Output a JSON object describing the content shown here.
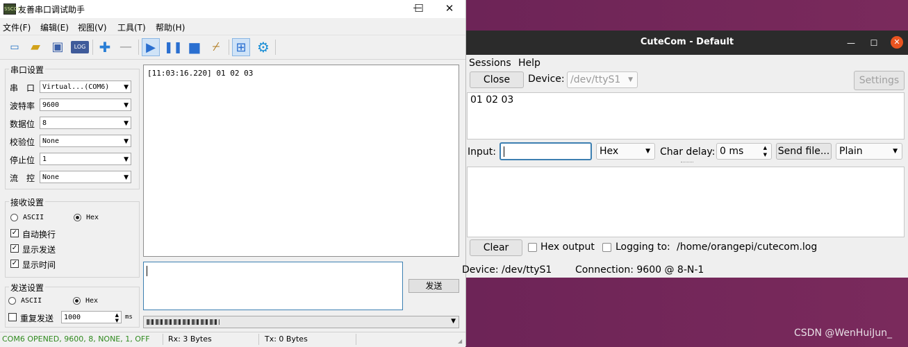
{
  "left_window": {
    "title": "友善串口调试助手",
    "window_buttons": {
      "minimize": "—",
      "maximize": "☐",
      "close": "✕"
    },
    "menu": [
      "文件(F)",
      "编辑(E)",
      "视图(V)",
      "工具(T)",
      "帮助(H)"
    ],
    "toolbar": [
      {
        "name": "new-icon",
        "glyph": "▭"
      },
      {
        "name": "open-icon",
        "glyph": "▰"
      },
      {
        "name": "save-icon",
        "glyph": "▣"
      },
      {
        "name": "log-icon",
        "glyph": "LOG"
      },
      {
        "name": "add-icon",
        "glyph": "✚"
      },
      {
        "name": "remove-icon",
        "glyph": "—"
      },
      {
        "name": "play-icon",
        "glyph": "▶"
      },
      {
        "name": "pause-icon",
        "glyph": "❚❚"
      },
      {
        "name": "stop-icon",
        "glyph": "■"
      },
      {
        "name": "clear-broom-icon",
        "glyph": "🧹"
      },
      {
        "name": "layout-icon",
        "glyph": "⊞"
      },
      {
        "name": "settings-gear-icon",
        "glyph": "⚙"
      }
    ],
    "serial_settings": {
      "title": "串口设置",
      "rows": [
        {
          "label": "串　口",
          "value": "Virtual...(COM6)"
        },
        {
          "label": "波特率",
          "value": "9600"
        },
        {
          "label": "数据位",
          "value": "8"
        },
        {
          "label": "校验位",
          "value": "None"
        },
        {
          "label": "停止位",
          "value": "1"
        },
        {
          "label": "流　控",
          "value": "None"
        }
      ]
    },
    "receive_settings": {
      "title": "接收设置",
      "ascii_label": "ASCII",
      "hex_label": "Hex",
      "selected": "Hex",
      "checkboxes": [
        {
          "label": "自动换行",
          "checked": true
        },
        {
          "label": "显示发送",
          "checked": true
        },
        {
          "label": "显示时间",
          "checked": true
        }
      ]
    },
    "send_settings": {
      "title": "发送设置",
      "ascii_label": "ASCII",
      "hex_label": "Hex",
      "selected": "Hex",
      "repeat_label": "重复发送",
      "repeat_checked": false,
      "interval_value": "1000",
      "interval_unit": "ms"
    },
    "receive_text": "[11:03:16.220] 01 02 03",
    "send_button": "发送",
    "status": {
      "port": "COM6 OPENED, 9600, 8, NONE, 1, OFF",
      "rx": "Rx: 3 Bytes",
      "tx": "Tx: 0 Bytes"
    },
    "colors": {
      "status_port": "#2f8a1e",
      "tx_border": "#3c7fb1"
    }
  },
  "right_window": {
    "title": "CuteCom - Default",
    "menu": [
      "Sessions",
      "Help"
    ],
    "close_button": "Close",
    "device_label": "Device:",
    "device_value": "/dev/ttyS1",
    "settings_button": "Settings",
    "output_text": "01 02 03",
    "input_label": "Input:",
    "input_value": "",
    "format_value": "Hex",
    "char_delay_label": "Char delay:",
    "char_delay_value": "0 ms",
    "send_file_button": "Send file...",
    "line_end_value": "Plain",
    "clear_button": "Clear",
    "hex_output_label": "Hex output",
    "logging_label": "Logging to:",
    "logging_path": "/home/orangepi/cutecom.log",
    "status_device": "Device:  /dev/ttyS1",
    "status_connection": "Connection:  9600 @ 8-N-1",
    "colors": {
      "titlebar": "#2b2b2b",
      "close_circle": "#e95420",
      "input_focus": "#3c7fb1"
    }
  },
  "watermark": "CSDN @WenHuiJun_"
}
